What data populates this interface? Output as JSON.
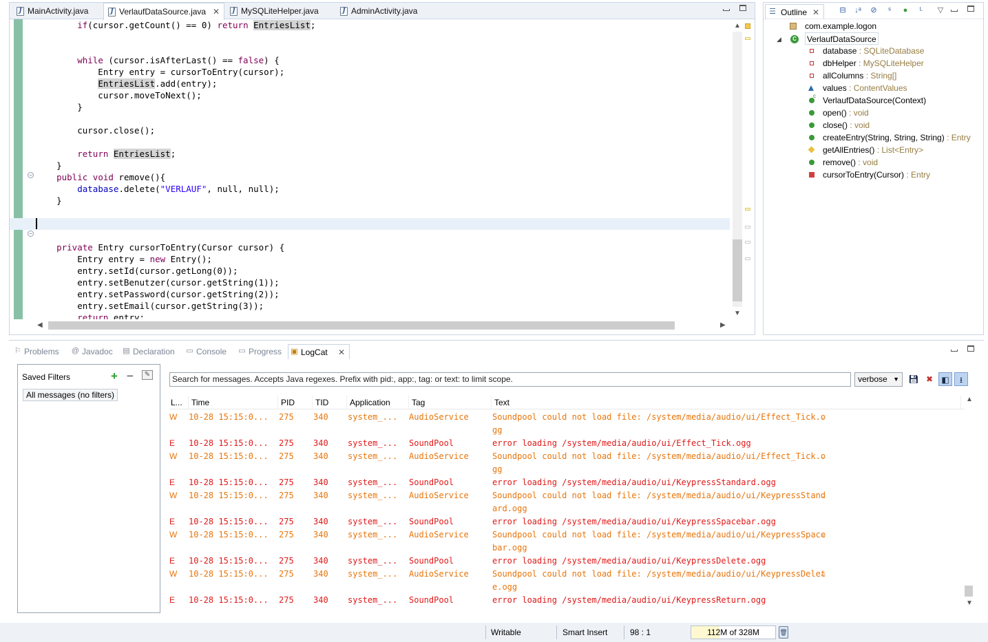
{
  "editor": {
    "tabs": [
      {
        "label": "MainActivity.java",
        "active": false
      },
      {
        "label": "VerlaufDataSource.java",
        "active": true
      },
      {
        "label": "MySQLiteHelper.java",
        "active": false
      },
      {
        "label": "AdminActivity.java",
        "active": false
      }
    ],
    "code": [
      "        if(cursor.getCount() == 0) return EntriesList;",
      "",
      "",
      "        while (cursor.isAfterLast() == false) {",
      "            Entry entry = cursorToEntry(cursor);",
      "            EntriesList.add(entry);",
      "            cursor.moveToNext();",
      "        }",
      "",
      "        cursor.close();",
      "",
      "        return EntriesList;",
      "    }",
      "    public void remove(){",
      "        database.delete(\"VERLAUF\", null, null);",
      "    }",
      "",
      "",
      "",
      "    private Entry cursorToEntry(Cursor cursor) {",
      "        Entry entry = new Entry();",
      "        entry.setId(cursor.getLong(0));",
      "        entry.setBenutzer(cursor.getString(1));",
      "        entry.setPassword(cursor.getString(2));",
      "        entry.setEmail(cursor.getString(3));",
      "        return entry;",
      "    }"
    ]
  },
  "outline": {
    "title": "Outline",
    "package": "com.example.logon",
    "class": "VerlaufDataSource",
    "members": [
      {
        "name": "database",
        "type": " : SQLiteDatabase",
        "icon": "private-field-icon"
      },
      {
        "name": "dbHelper",
        "type": " : MySQLiteHelper",
        "icon": "private-field-icon"
      },
      {
        "name": "allColumns",
        "type": " : String[]",
        "icon": "private-field-icon"
      },
      {
        "name": "values",
        "type": " : ContentValues",
        "icon": "package-field-icon"
      },
      {
        "name": "VerlaufDataSource(Context)",
        "type": "",
        "icon": "constructor-icon"
      },
      {
        "name": "open()",
        "type": " : void",
        "icon": "public-method-icon"
      },
      {
        "name": "close()",
        "type": " : void",
        "icon": "public-method-icon"
      },
      {
        "name": "createEntry(String, String, String)",
        "type": " : Entry",
        "icon": "public-method-icon"
      },
      {
        "name": "getAllEntries()",
        "type": " : List<Entry>",
        "icon": "protected-method-icon"
      },
      {
        "name": "remove()",
        "type": " : void",
        "icon": "public-method-icon"
      },
      {
        "name": "cursorToEntry(Cursor)",
        "type": " : Entry",
        "icon": "private-method-icon"
      }
    ]
  },
  "bottom": {
    "tabs": [
      {
        "label": "Problems",
        "icon": "problems-icon",
        "active": false
      },
      {
        "label": "Javadoc",
        "icon": "javadoc-icon",
        "active": false
      },
      {
        "label": "Declaration",
        "icon": "declaration-icon",
        "active": false
      },
      {
        "label": "Console",
        "icon": "console-icon",
        "active": false
      },
      {
        "label": "Progress",
        "icon": "progress-icon",
        "active": false
      },
      {
        "label": "LogCat",
        "icon": "logcat-icon",
        "active": true
      }
    ],
    "filters": {
      "title": "Saved Filters",
      "all_label": "All messages (no filters)"
    },
    "search_placeholder": "Search for messages. Accepts Java regexes. Prefix with pid:, app:, tag: or text: to limit scope.",
    "level": "verbose",
    "columns": [
      "L...",
      "Time",
      "PID",
      "TID",
      "Application",
      "Tag",
      "Text"
    ],
    "rows": [
      {
        "level": "W",
        "time": "10-28 15:15:0...",
        "pid": "275",
        "tid": "340",
        "app": "system_...",
        "tag": "AudioService",
        "text": "Soundpool could not load file: /system/media/audio/ui/Effect_Tick.o",
        "cont": "gg"
      },
      {
        "level": "E",
        "time": "10-28 15:15:0...",
        "pid": "275",
        "tid": "340",
        "app": "system_...",
        "tag": "SoundPool",
        "text": "error loading /system/media/audio/ui/Effect_Tick.ogg",
        "cont": ""
      },
      {
        "level": "W",
        "time": "10-28 15:15:0...",
        "pid": "275",
        "tid": "340",
        "app": "system_...",
        "tag": "AudioService",
        "text": "Soundpool could not load file: /system/media/audio/ui/Effect_Tick.o",
        "cont": "gg"
      },
      {
        "level": "E",
        "time": "10-28 15:15:0...",
        "pid": "275",
        "tid": "340",
        "app": "system_...",
        "tag": "SoundPool",
        "text": "error loading /system/media/audio/ui/KeypressStandard.ogg",
        "cont": ""
      },
      {
        "level": "W",
        "time": "10-28 15:15:0...",
        "pid": "275",
        "tid": "340",
        "app": "system_...",
        "tag": "AudioService",
        "text": "Soundpool could not load file: /system/media/audio/ui/KeypressStand",
        "cont": "ard.ogg"
      },
      {
        "level": "E",
        "time": "10-28 15:15:0...",
        "pid": "275",
        "tid": "340",
        "app": "system_...",
        "tag": "SoundPool",
        "text": "error loading /system/media/audio/ui/KeypressSpacebar.ogg",
        "cont": ""
      },
      {
        "level": "W",
        "time": "10-28 15:15:0...",
        "pid": "275",
        "tid": "340",
        "app": "system_...",
        "tag": "AudioService",
        "text": "Soundpool could not load file: /system/media/audio/ui/KeypressSpace",
        "cont": "bar.ogg"
      },
      {
        "level": "E",
        "time": "10-28 15:15:0...",
        "pid": "275",
        "tid": "340",
        "app": "system_...",
        "tag": "SoundPool",
        "text": "error loading /system/media/audio/ui/KeypressDelete.ogg",
        "cont": ""
      },
      {
        "level": "W",
        "time": "10-28 15:15:0...",
        "pid": "275",
        "tid": "340",
        "app": "system_...",
        "tag": "AudioService",
        "text": "Soundpool could not load file: /system/media/audio/ui/KeypressDelet",
        "cont": "e.ogg"
      },
      {
        "level": "E",
        "time": "10-28 15:15:0...",
        "pid": "275",
        "tid": "340",
        "app": "system_...",
        "tag": "SoundPool",
        "text": "error loading /system/media/audio/ui/KeypressReturn.ogg",
        "cont": ""
      }
    ]
  },
  "status": {
    "writable": "Writable",
    "insert_mode": "Smart Insert",
    "position": "98 : 1",
    "heap": "112M of 328M",
    "heap_used_fraction": 0.34
  },
  "colors": {
    "warn": "#e8750a",
    "error": "#e01818",
    "keyword": "#7f0055",
    "field": "#0000c0",
    "string": "#2a00ff"
  }
}
